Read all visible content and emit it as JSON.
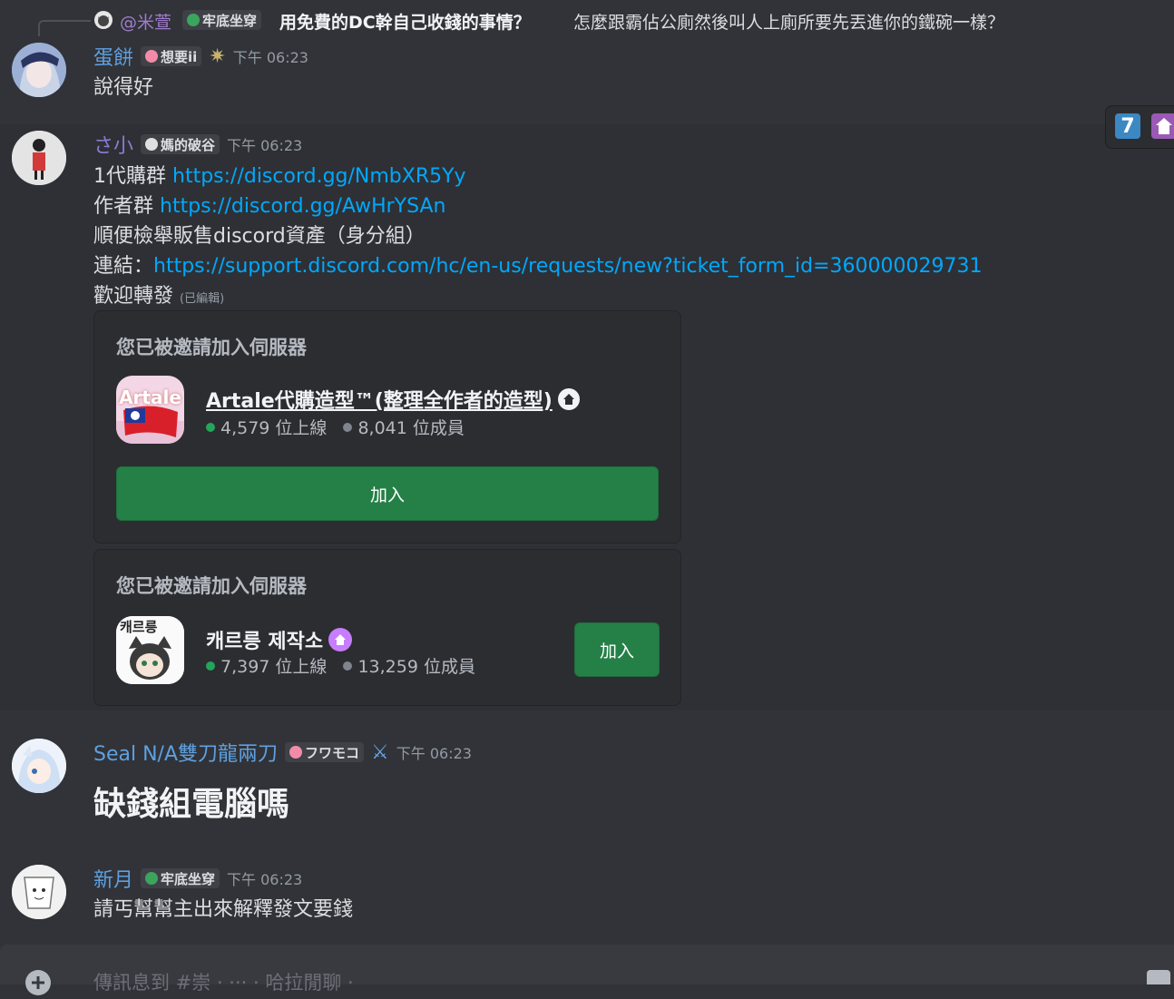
{
  "reply": {
    "author": "@米萱",
    "role": "牢底坐穿",
    "text_bold": "用免費的DC幹自己收錢的事情？",
    "text_rest": "怎麼跟霸佔公廁然後叫人上廁所要先丟進你的鐵碗一樣？"
  },
  "messages": [
    {
      "author": "蛋餅",
      "author_color": "#5ea0e0",
      "role": "想要ii",
      "timestamp": "下午 06:23",
      "lines": [
        "說得好"
      ]
    },
    {
      "author": "さ小",
      "author_color": "#8c7bd6",
      "role": "媽的破谷",
      "timestamp": "下午 06:23",
      "line1_prefix": "1代購群 ",
      "line1_link": "https://discord.gg/NmbXR5Yy",
      "line2_prefix": "作者群 ",
      "line2_link": "https://discord.gg/AwHrYSAn",
      "line3": "順便檢舉販售discord資產（身分組）",
      "line4_prefix": "連結：",
      "line4_link": "https://support.discord.com/hc/en-us/requests/new?ticket_form_id=360000029731",
      "line5": "歡迎轉發",
      "edited": "(已編輯)"
    },
    {
      "author": "Seal N/A雙刀龍兩刀",
      "author_color": "#5ea0e0",
      "role": "フワモコ",
      "timestamp": "下午 06:23",
      "text": "缺錢組電腦嗎"
    },
    {
      "author": "新月",
      "author_color": "#5ea0e0",
      "role": "牢底坐穿",
      "timestamp": "下午 06:23",
      "text": "請丐幫幫主出來解釋發文要錢"
    }
  ],
  "invites": [
    {
      "title": "您已被邀請加入伺服器",
      "guild_name": "Artale代購造型™(整理全作者的造型)",
      "online": "4,579 位上線",
      "members": "8,041 位成員",
      "join": "加入",
      "icon_label": "Artale"
    },
    {
      "title": "您已被邀請加入伺服器",
      "guild_name": "캐르릉 제작소",
      "online": "7,397 位上線",
      "members": "13,259 位成員",
      "join": "加入",
      "icon_label": "캐르릉"
    }
  ],
  "side": {
    "number": "7"
  },
  "composer": {
    "placeholder": "傳訊息到 #崇 · ··· · 哈拉閒聊 ·"
  },
  "colors": {
    "link": "#00a8fc",
    "join": "#248046",
    "online": "#23a55a"
  }
}
